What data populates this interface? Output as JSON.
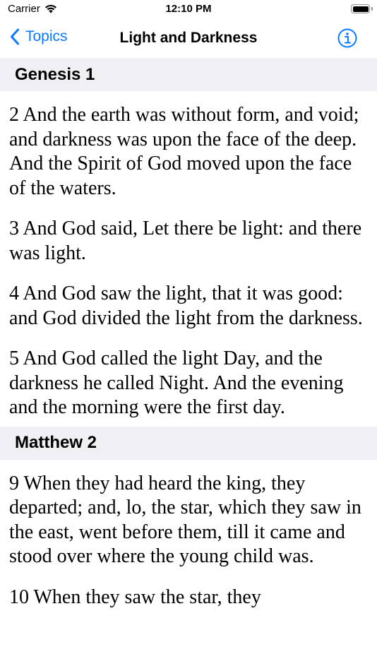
{
  "status_bar": {
    "carrier": "Carrier",
    "time": "12:10 PM"
  },
  "nav": {
    "back_label": "Topics",
    "title": "Light and Darkness",
    "accent_color": "#0a7aff"
  },
  "sections": [
    {
      "header": "Genesis 1",
      "verses": [
        "2  And the earth was without form, and void; and darkness was upon the face of the deep. And the Spirit of God moved upon the face of the waters.",
        "3  And God said, Let there be light: and there was light.",
        "4  And God saw the light, that it was good: and God divided the light from the darkness.",
        "5  And God called the light Day, and the darkness he called Night. And the evening and the morning were the first day."
      ]
    },
    {
      "header": "Matthew 2",
      "verses": [
        "9  When they had heard the king, they departed; and, lo, the star, which they saw in the east, went before them, till it came and stood over where the young child was.",
        "10  When they saw the star, they"
      ]
    }
  ]
}
